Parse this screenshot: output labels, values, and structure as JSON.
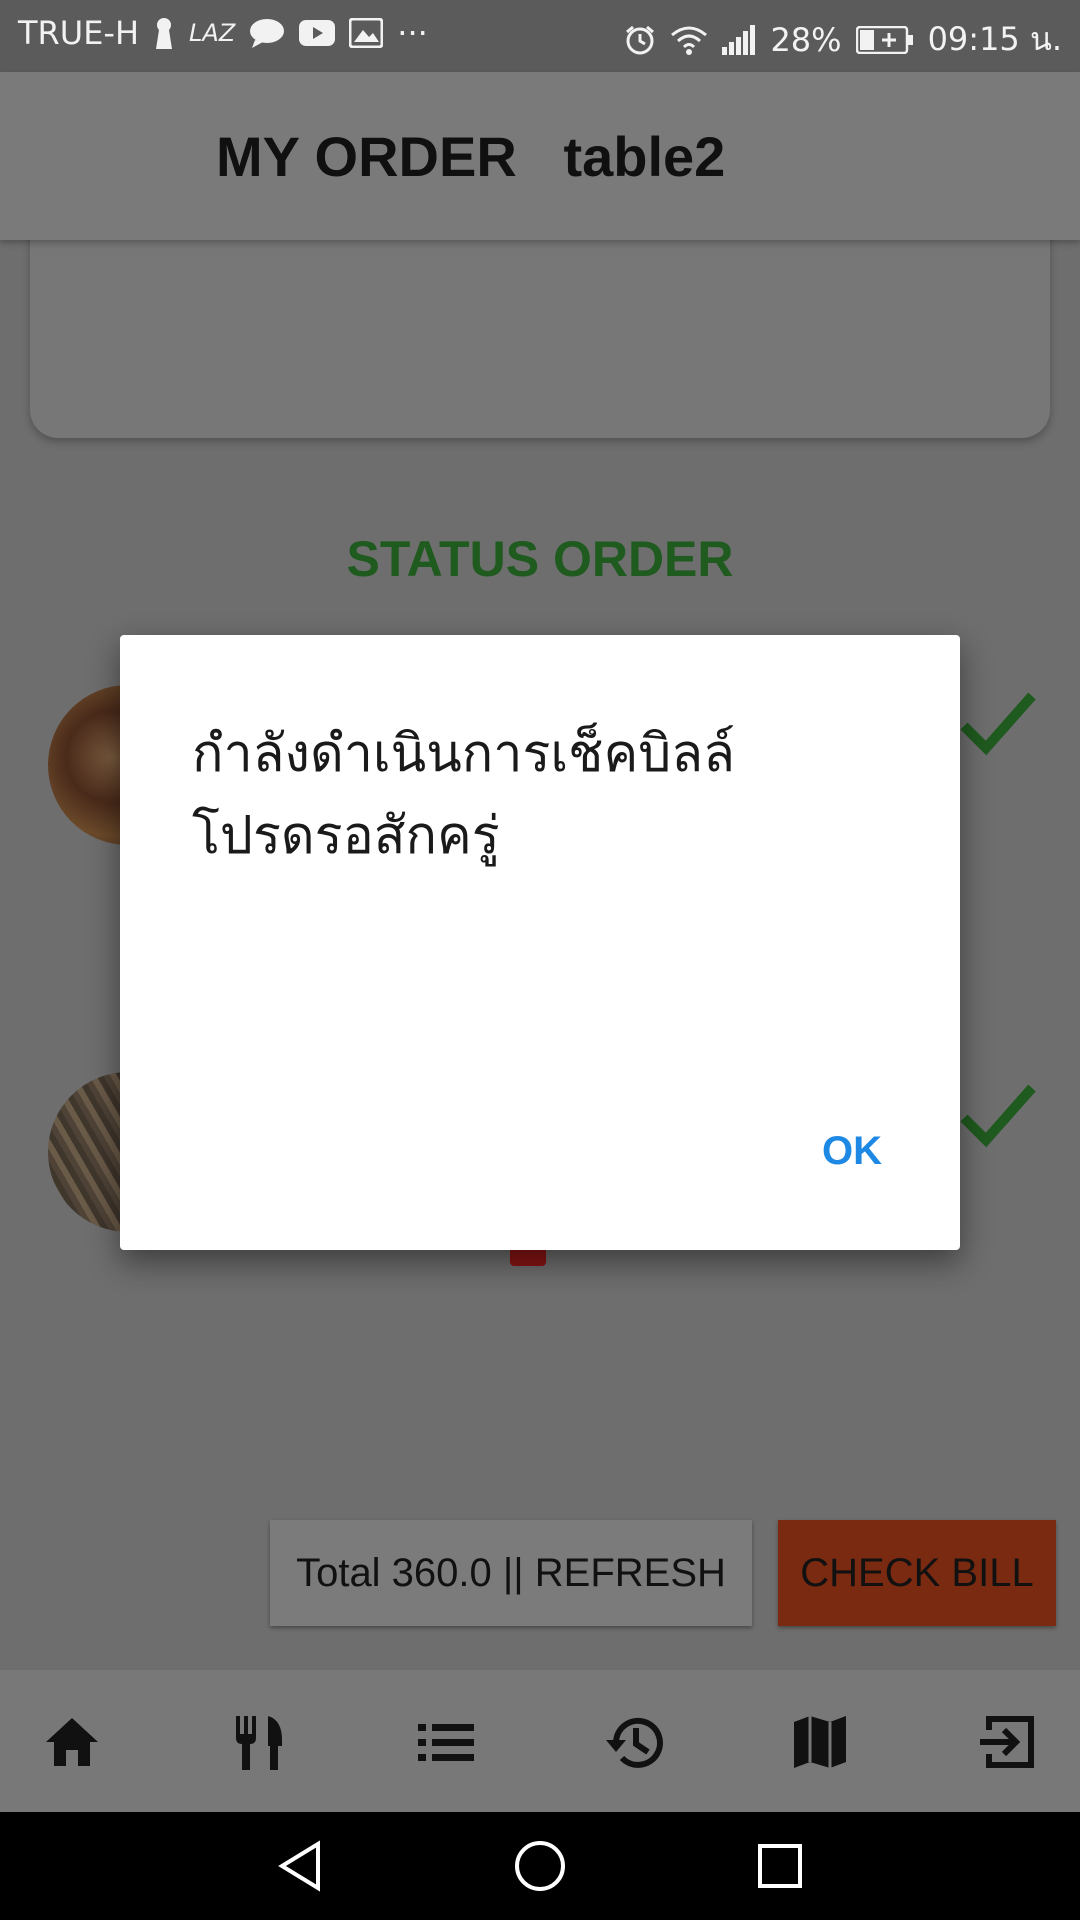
{
  "status_bar": {
    "carrier": "TRUE-H",
    "app_text": "LAZ",
    "overflow": "···",
    "battery": "28%",
    "time": "09:15 น.",
    "icons": [
      "keyhole-icon",
      "chat-icon",
      "youtube-icon",
      "gallery-icon",
      "alarm-icon",
      "wifi-icon",
      "signal-icon",
      "battery-charging-icon"
    ]
  },
  "app_bar": {
    "title": "MY ORDER   table2"
  },
  "main": {
    "status_heading": "STATUS ORDER"
  },
  "actions": {
    "total_refresh_label": "Total 360.0 || REFRESH",
    "check_bill_label": "CHECK BILL"
  },
  "bottom_nav": {
    "items": [
      "home-icon",
      "restaurant-icon",
      "list-icon",
      "history-icon",
      "map-icon",
      "exit-icon"
    ]
  },
  "dialog": {
    "message": "กำลังดำเนินการเช็คบิลล์\nโปรดรอสักครู่",
    "ok_label": "OK"
  },
  "colors": {
    "status_heading": "#1f5a1f",
    "check_bill_bg": "#7a2a10",
    "dialog_button": "#1e88e5"
  }
}
